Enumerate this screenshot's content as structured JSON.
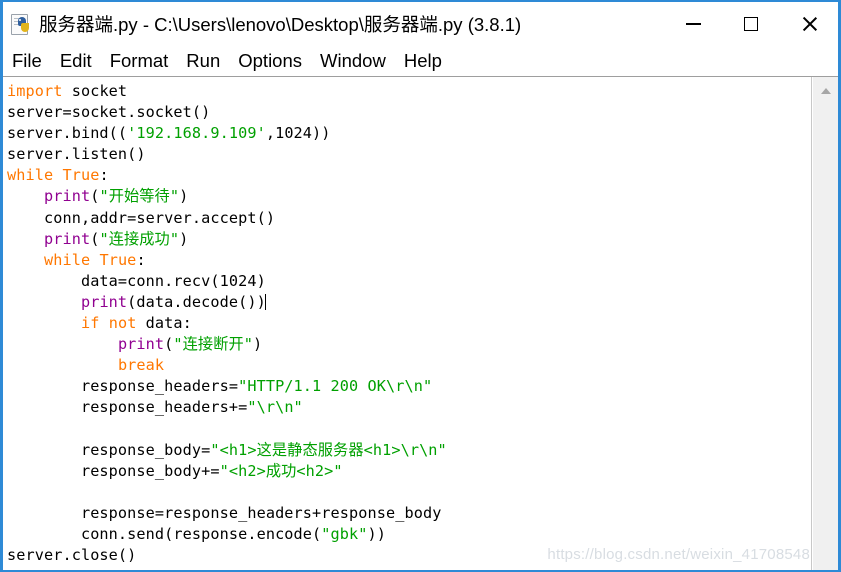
{
  "window": {
    "title": "服务器端.py - C:\\Users\\lenovo\\Desktop\\服务器端.py (3.8.1)",
    "icon": "python-file-icon",
    "border_color": "#2e8ad6",
    "controls": {
      "minimize": "minimize-icon",
      "maximize": "maximize-icon",
      "close": "close-icon"
    }
  },
  "menubar": {
    "items": [
      {
        "label": "File"
      },
      {
        "label": "Edit"
      },
      {
        "label": "Format"
      },
      {
        "label": "Run"
      },
      {
        "label": "Options"
      },
      {
        "label": "Window"
      },
      {
        "label": "Help"
      }
    ]
  },
  "editor": {
    "language": "python",
    "colors": {
      "keyword": "#ff7700",
      "builtin": "#900090",
      "string": "#00a000",
      "plain": "#000000",
      "background": "#ffffff"
    },
    "caret_line": 11,
    "lines": [
      [
        {
          "t": "import",
          "c": "kw"
        },
        {
          "t": " socket",
          "c": "pl"
        }
      ],
      [
        {
          "t": "server=socket.socket()",
          "c": "pl"
        }
      ],
      [
        {
          "t": "server.bind((",
          "c": "pl"
        },
        {
          "t": "'192.168.9.109'",
          "c": "str"
        },
        {
          "t": ",1024))",
          "c": "pl"
        }
      ],
      [
        {
          "t": "server.listen()",
          "c": "pl"
        }
      ],
      [
        {
          "t": "while",
          "c": "kw"
        },
        {
          "t": " ",
          "c": "pl"
        },
        {
          "t": "True",
          "c": "kw"
        },
        {
          "t": ":",
          "c": "pl"
        }
      ],
      [
        {
          "t": "    ",
          "c": "pl"
        },
        {
          "t": "print",
          "c": "bif"
        },
        {
          "t": "(",
          "c": "pl"
        },
        {
          "t": "\"开始等待\"",
          "c": "str"
        },
        {
          "t": ")",
          "c": "pl"
        }
      ],
      [
        {
          "t": "    conn,addr=server.accept()",
          "c": "pl"
        }
      ],
      [
        {
          "t": "    ",
          "c": "pl"
        },
        {
          "t": "print",
          "c": "bif"
        },
        {
          "t": "(",
          "c": "pl"
        },
        {
          "t": "\"连接成功\"",
          "c": "str"
        },
        {
          "t": ")",
          "c": "pl"
        }
      ],
      [
        {
          "t": "    ",
          "c": "pl"
        },
        {
          "t": "while",
          "c": "kw"
        },
        {
          "t": " ",
          "c": "pl"
        },
        {
          "t": "True",
          "c": "kw"
        },
        {
          "t": ":",
          "c": "pl"
        }
      ],
      [
        {
          "t": "        data=conn.recv(1024)",
          "c": "pl"
        }
      ],
      [
        {
          "t": "        ",
          "c": "pl"
        },
        {
          "t": "print",
          "c": "bif"
        },
        {
          "t": "(data.decode())",
          "c": "pl"
        },
        {
          "t": "|CARET|",
          "c": "caret"
        }
      ],
      [
        {
          "t": "        ",
          "c": "pl"
        },
        {
          "t": "if",
          "c": "kw"
        },
        {
          "t": " ",
          "c": "pl"
        },
        {
          "t": "not",
          "c": "kw"
        },
        {
          "t": " data:",
          "c": "pl"
        }
      ],
      [
        {
          "t": "            ",
          "c": "pl"
        },
        {
          "t": "print",
          "c": "bif"
        },
        {
          "t": "(",
          "c": "pl"
        },
        {
          "t": "\"连接断开\"",
          "c": "str"
        },
        {
          "t": ")",
          "c": "pl"
        }
      ],
      [
        {
          "t": "            ",
          "c": "pl"
        },
        {
          "t": "break",
          "c": "kw"
        }
      ],
      [
        {
          "t": "        response_headers=",
          "c": "pl"
        },
        {
          "t": "\"HTTP/1.1 200 OK\\r\\n\"",
          "c": "str"
        }
      ],
      [
        {
          "t": "        response_headers+=",
          "c": "pl"
        },
        {
          "t": "\"\\r\\n\"",
          "c": "str"
        }
      ],
      [
        {
          "t": "",
          "c": "pl"
        }
      ],
      [
        {
          "t": "        response_body=",
          "c": "pl"
        },
        {
          "t": "\"<h1>这是静态服务器<h1>\\r\\n\"",
          "c": "str"
        }
      ],
      [
        {
          "t": "        response_body+=",
          "c": "pl"
        },
        {
          "t": "\"<h2>成功<h2>\"",
          "c": "str"
        }
      ],
      [
        {
          "t": "",
          "c": "pl"
        }
      ],
      [
        {
          "t": "        response=response_headers+response_body",
          "c": "pl"
        }
      ],
      [
        {
          "t": "        conn.send(response.encode(",
          "c": "pl"
        },
        {
          "t": "\"gbk\"",
          "c": "str"
        },
        {
          "t": "))",
          "c": "pl"
        }
      ],
      [
        {
          "t": "server.close()",
          "c": "pl"
        }
      ]
    ]
  },
  "scrollbar": {
    "up_arrow": "chevron-up-icon"
  },
  "watermark": {
    "text": "https://blog.csdn.net/weixin_41708548"
  }
}
